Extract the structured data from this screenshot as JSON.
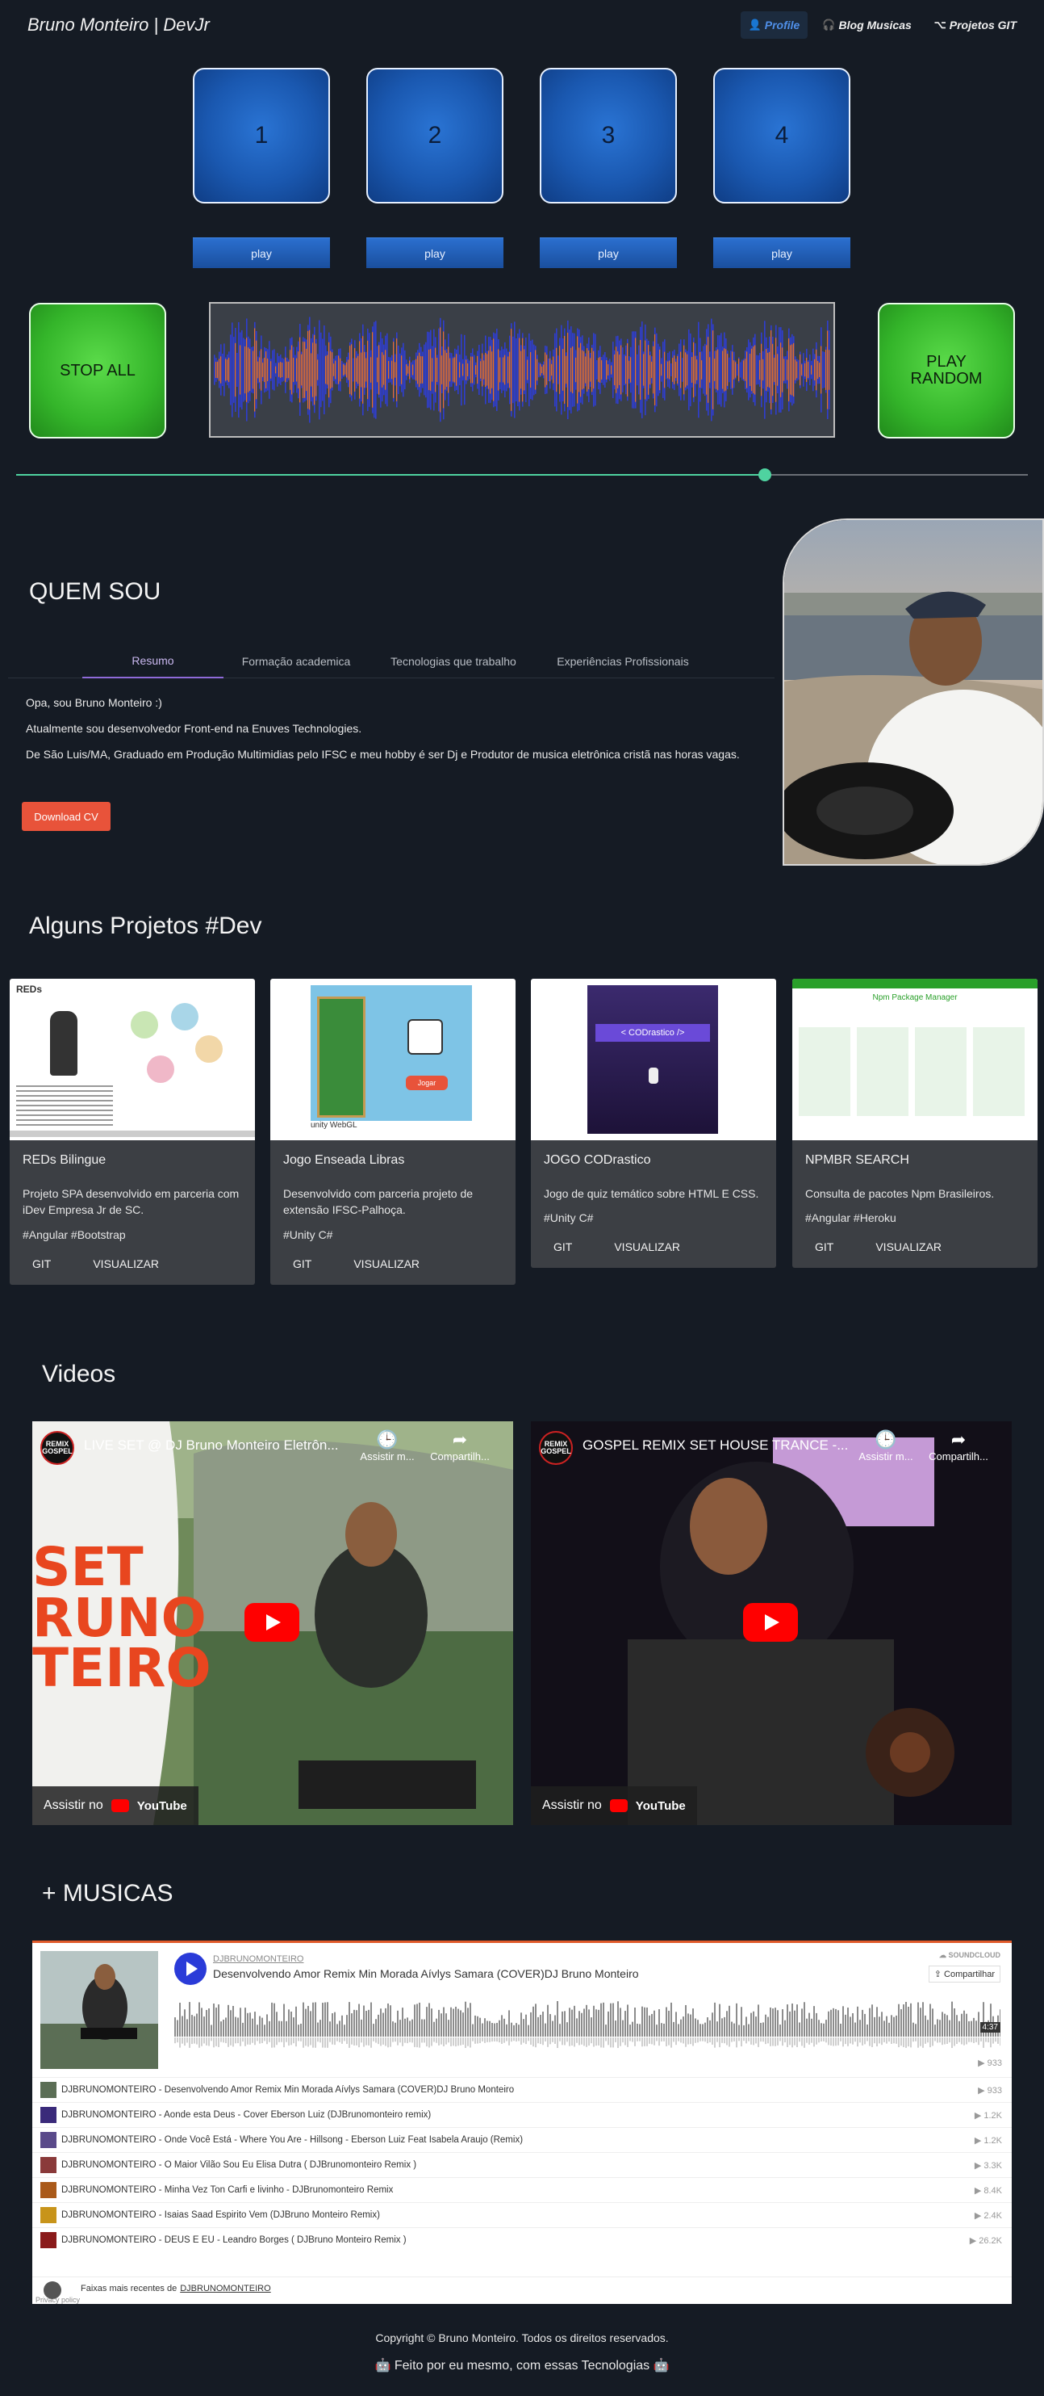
{
  "header": {
    "brand": "Bruno Monteiro | DevJr",
    "nav": [
      {
        "label": "Profile",
        "icon": "user-icon"
      },
      {
        "label": "Blog Musicas",
        "icon": "headphones-icon"
      },
      {
        "label": "Projetos GIT",
        "icon": "code-icon"
      }
    ]
  },
  "player": {
    "pads": [
      "1",
      "2",
      "3",
      "4"
    ],
    "play_label": "play",
    "stop_all": "STOP ALL",
    "play_random_line1": "PLAY",
    "play_random_line2": "RANDOM",
    "progress": 0.74
  },
  "about": {
    "title": "QUEM SOU",
    "tabs": [
      "Resumo",
      "Formação academica",
      "Tecnologias que trabalho",
      "Experiências Profissionais"
    ],
    "active_tab": 0,
    "paragraphs": [
      "Opa, sou Bruno Monteiro :)",
      "Atualmente sou desenvolvedor Front-end na Enuves Technologies.",
      "De São Luis/MA, Graduado em Produção Multimidias pelo IFSC e meu hobby é ser Dj e Produtor de musica eletrônica cristã nas horas vagas."
    ],
    "cv_button": "Download CV"
  },
  "projects": {
    "title": "Alguns Projetos #Dev",
    "git_label": "GIT",
    "view_label": "VISUALIZAR",
    "items": [
      {
        "title": "REDs Bilingue",
        "desc": "Projeto SPA desenvolvido em parceria com iDev Empresa Jr de SC.",
        "tags": "#Angular #Bootstrap"
      },
      {
        "title": "Jogo Enseada Libras",
        "desc": "Desenvolvido com parceria projeto de extensão IFSC-Palhoça.",
        "tags": "#Unity C#"
      },
      {
        "title": "JOGO CODrastico",
        "desc": "Jogo de quiz temático sobre HTML E CSS.",
        "tags": "#Unity C#"
      },
      {
        "title": "NPMBR SEARCH",
        "desc": "Consulta de pacotes Npm Brasileiros.",
        "tags": "#Angular #Heroku"
      }
    ],
    "thumb_text": {
      "reds": "REDs",
      "unity": "unity WebGL",
      "start": "Jogar",
      "cod": "< CODrastico />",
      "npm": "Npm Package Manager"
    }
  },
  "videos": {
    "title": "Videos",
    "watch_label": "Assistir no",
    "youtube": "YouTube",
    "watch_later": "Assistir m...",
    "share": "Compartilh...",
    "channel_logo": "REMIX GOSPEL",
    "items": [
      {
        "title": "LIVE SET @ DJ Bruno Monteiro Eletrôn...",
        "overlay1": "SET",
        "overlay2": "RUNO",
        "overlay3": "TEIRO"
      },
      {
        "title": "GOSPEL REMIX SET HOUSE TRANCE -..."
      }
    ]
  },
  "music": {
    "title": "+ MUSICAS",
    "user": "DJBRUNOMONTEIRO",
    "track": "Desenvolvendo Amor Remix Min Morada Aívlys Samara (COVER)DJ Bruno Monteiro",
    "brand": "SOUNDCLOUD",
    "share": "Compartilhar",
    "duration": "4:37",
    "plays": "933",
    "list": [
      {
        "title": "DJBRUNOMONTEIRO - Desenvolvendo Amor Remix Min Morada Aívlys Samara (COVER)DJ Bruno Monteiro",
        "count": "933"
      },
      {
        "title": "DJBRUNOMONTEIRO - Aonde esta Deus - Cover Eberson Luiz (DJBrunomonteiro remix)",
        "count": "1.2K"
      },
      {
        "title": "DJBRUNOMONTEIRO - Onde Você Está - Where You Are - Hillsong - Eberson Luiz Feat Isabela Araujo (Remix)",
        "count": "1.2K"
      },
      {
        "title": "DJBRUNOMONTEIRO - O Maior Vilão Sou Eu Elisa Dutra ( DJBrunomonteiro Remix )",
        "count": "3.3K"
      },
      {
        "title": "DJBRUNOMONTEIRO - Minha Vez Ton Carfi e livinho - DJBrunomonteiro Remix",
        "count": "8.4K"
      },
      {
        "title": "DJBRUNOMONTEIRO - Isaias Saad Espirito Vem (DJBruno Monteiro Remix)",
        "count": "2.4K"
      },
      {
        "title": "DJBRUNOMONTEIRO - DEUS E EU - Leandro Borges ( DJBruno Monteiro Remix )",
        "count": "26.2K"
      }
    ],
    "footer_text": "Faixas mais recentes de",
    "footer_user": "DJBRUNOMONTEIRO",
    "privacy": "Privacy policy"
  },
  "footer": {
    "copyright": "Copyright © Bruno Monteiro. Todos os direitos reservados.",
    "made": "Feito por eu mesmo, com essas Tecnologias",
    "robot": "🤖"
  },
  "colors": {
    "background": "#151b24",
    "pad_blue": "#1a58b0",
    "green": "#34b52a",
    "accent_slider": "#4fd3a0",
    "cv_button": "#e8533a",
    "tab_active": "#8e6ad8",
    "soundcloud_orange": "#e05a2a"
  }
}
